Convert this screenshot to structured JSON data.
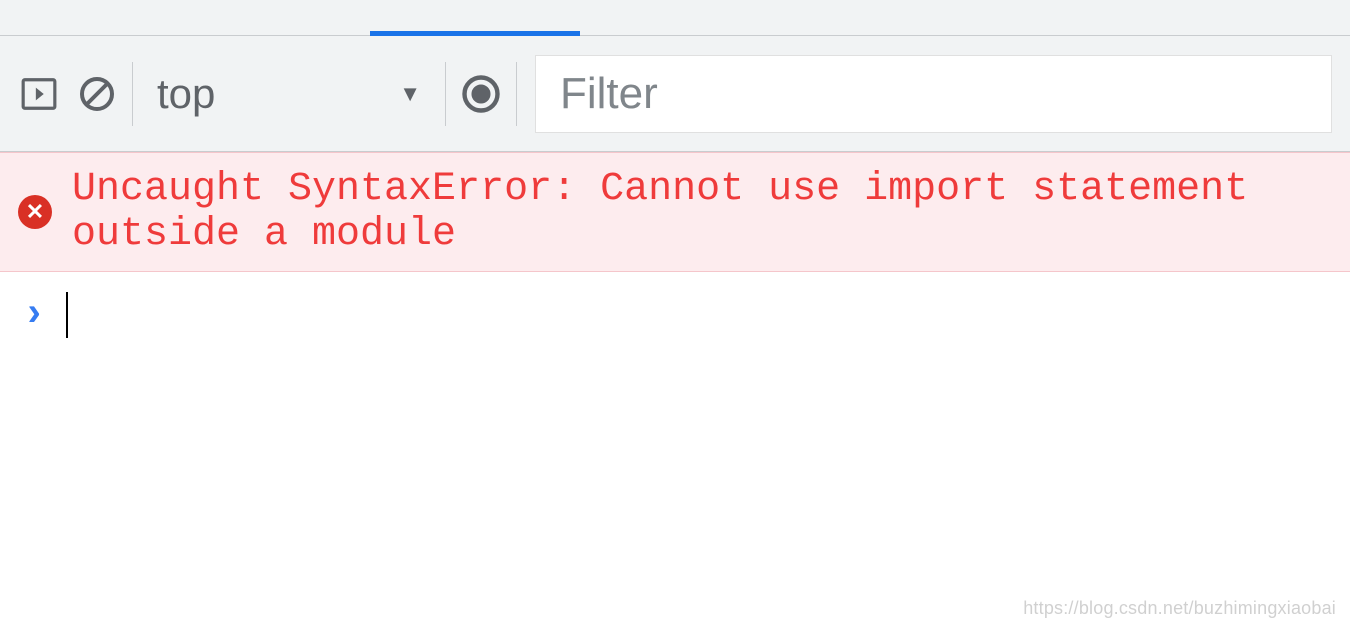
{
  "toolbar": {
    "context_label": "top",
    "filter_placeholder": "Filter"
  },
  "console": {
    "error_message": "Uncaught SyntaxError: Cannot use import statement outside a module",
    "prompt_symbol": "›"
  },
  "watermark": "https://blog.csdn.net/buzhimingxiaobai"
}
